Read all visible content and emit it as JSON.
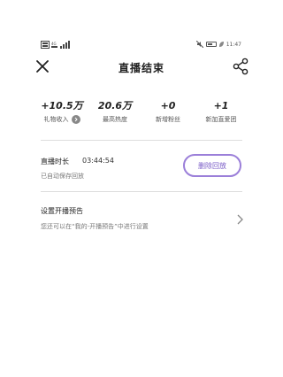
{
  "status_bar": {
    "time": "11:47",
    "icons": [
      "sim-icon",
      "wifi-icon",
      "signal-icon",
      "mute-icon",
      "battery-icon"
    ]
  },
  "header": {
    "title": "直播结束"
  },
  "stats": [
    {
      "value": "+10.5万",
      "label": "礼物收入"
    },
    {
      "value": "20.6万",
      "label": "最高热度"
    },
    {
      "value": "+0",
      "label": "新增粉丝"
    },
    {
      "value": "+1",
      "label": "新加直爱团"
    }
  ],
  "session": {
    "duration_label": "直播时长",
    "duration_value": "03:44:54",
    "auto_saved": "已自动保存回放",
    "delete_button": "删除回放"
  },
  "preview": {
    "title": "设置开播预告",
    "description": "您还可以在“我的-开播预告”中进行设置"
  },
  "colors": {
    "accent": "#9b7fd9",
    "accent_text": "#7a5cc7",
    "divider": "#dddddd"
  }
}
